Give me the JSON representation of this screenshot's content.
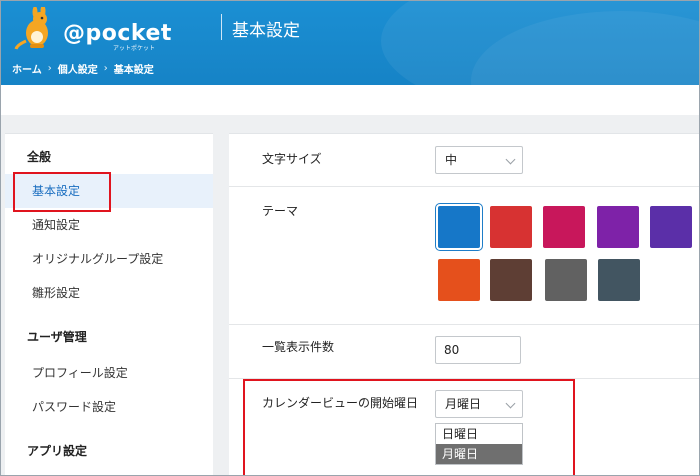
{
  "app": {
    "logo_text": "@pocket",
    "logo_sub": "アットポケット",
    "page_title": "基本設定"
  },
  "breadcrumb": {
    "items": [
      "ホーム",
      "個人設定",
      "基本設定"
    ],
    "separator": "›"
  },
  "sidebar": {
    "sections": [
      {
        "title": "全般",
        "items": [
          "基本設定",
          "通知設定",
          "オリジナルグループ設定",
          "雛形設定"
        ]
      },
      {
        "title": "ユーザ管理",
        "items": [
          "プロフィール設定",
          "パスワード設定"
        ]
      },
      {
        "title": "アプリ設定",
        "items": []
      }
    ],
    "active_item": "基本設定"
  },
  "settings": {
    "font_size": {
      "label": "文字サイズ",
      "value": "中"
    },
    "theme": {
      "label": "テーマ",
      "colors": [
        "#1677c8",
        "#d73232",
        "#c8175b",
        "#7e22a8",
        "#5b2fa8",
        "#e5501c",
        "#5e3e34",
        "#616161",
        "#425561"
      ],
      "selected_index": 0
    },
    "list_count": {
      "label": "一覧表示件数",
      "value": "80"
    },
    "calendar_start": {
      "label": "カレンダービューの開始曜日",
      "value": "月曜日",
      "options": [
        "日曜日",
        "月曜日"
      ],
      "highlighted_option": "月曜日"
    }
  }
}
